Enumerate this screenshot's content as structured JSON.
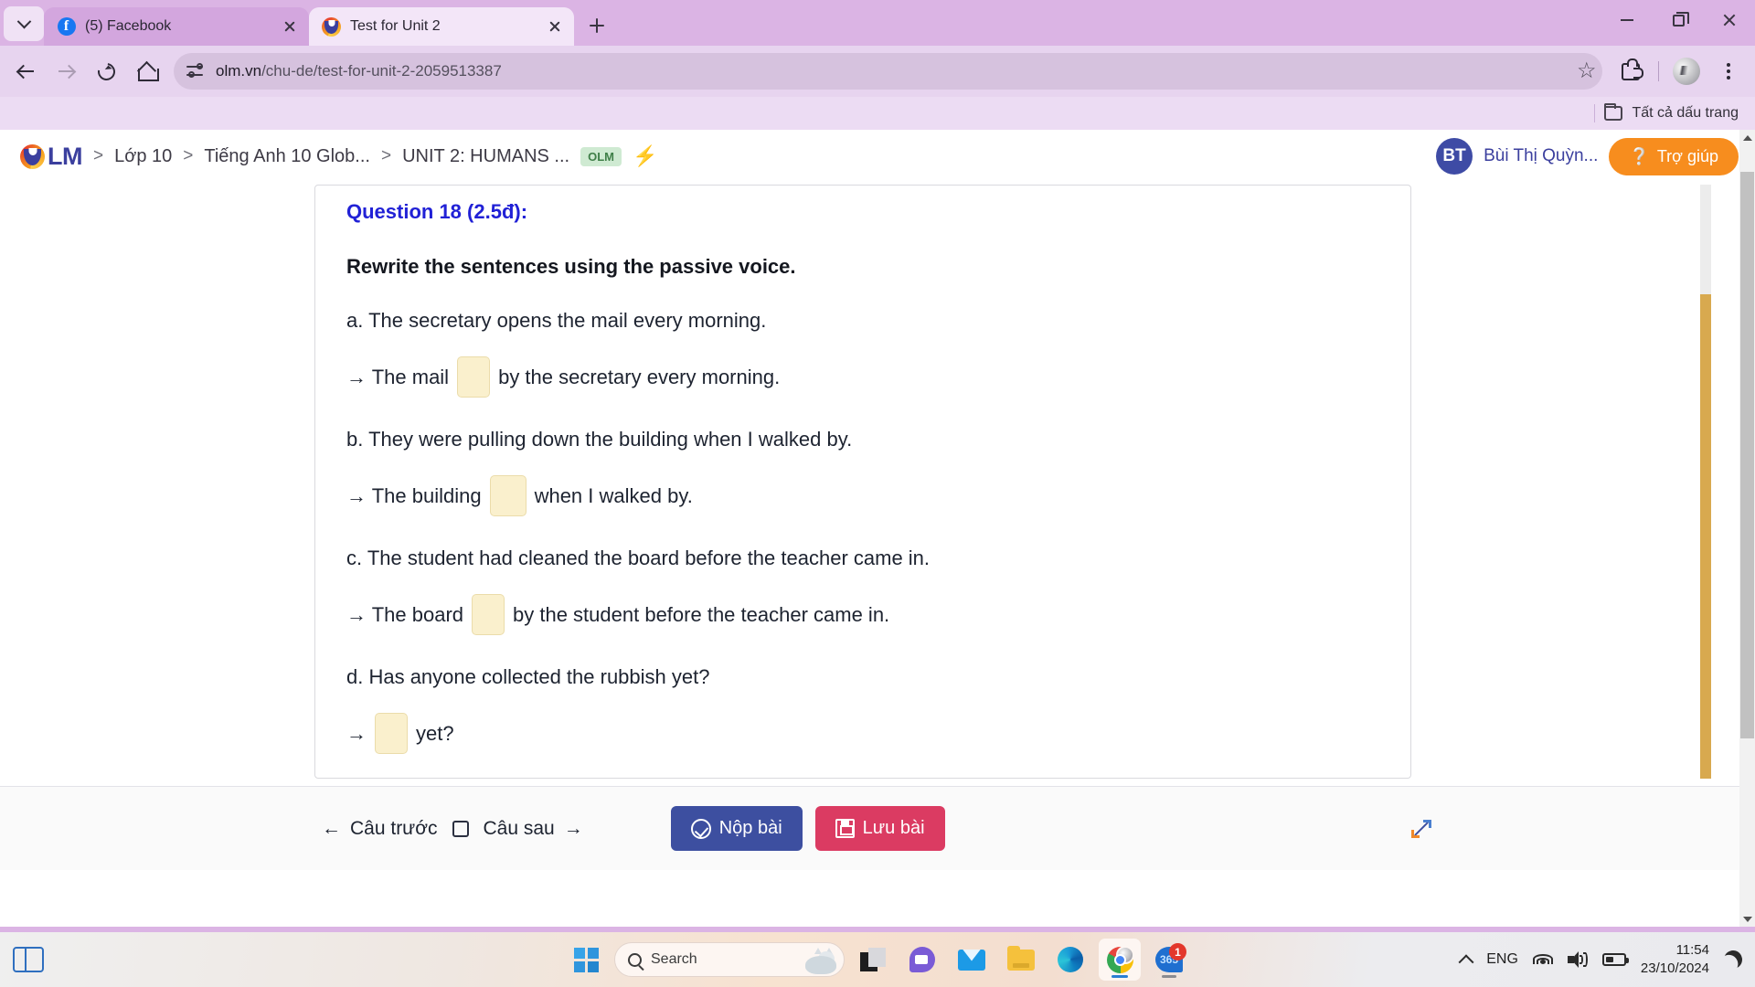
{
  "browser": {
    "tabs": [
      {
        "title": "(5) Facebook",
        "favicon": "facebook-icon",
        "active": false
      },
      {
        "title": "Test for Unit 2",
        "favicon": "olm-icon",
        "active": true
      }
    ],
    "new_tab_label": "+",
    "url_host": "olm.vn",
    "url_path": "/chu-de/test-for-unit-2-2059513387",
    "bookmarks_label": "Tất cả dấu trang"
  },
  "olm_header": {
    "logo_text": "LM",
    "breadcrumb": [
      {
        "label": "Lớp 10"
      },
      {
        "label": "Tiếng Anh 10 Glob..."
      },
      {
        "label": "UNIT 2: HUMANS ..."
      }
    ],
    "separator": ">",
    "badge": "OLM",
    "user_initials": "BT",
    "user_name": "Bùi Thị Quỳn...",
    "help_label": "Trợ giúp"
  },
  "question": {
    "title": "Question 18 (2.5đ):",
    "instruction": "Rewrite the sentences using the passive voice.",
    "items": [
      {
        "prompt": "a. The secretary opens the mail every morning.",
        "answer_prefix": "→ The mail",
        "answer_suffix": "by the secretary every morning.",
        "blank_value": ""
      },
      {
        "prompt": "b. They were pulling down the building when I walked by.",
        "answer_prefix": "→ The building",
        "answer_suffix": "when I walked by.",
        "blank_value": ""
      },
      {
        "prompt": "c. The student had cleaned the board before the teacher came in.",
        "answer_prefix": "→ The board",
        "answer_suffix": "by the student before the teacher came in.",
        "blank_value": ""
      },
      {
        "prompt": "d. Has anyone collected the rubbish yet?",
        "answer_prefix": "→",
        "answer_suffix": "yet?",
        "blank_value": ""
      }
    ]
  },
  "actionbar": {
    "prev_label": "Câu trước",
    "next_label": "Câu sau",
    "submit_label": "Nộp bài",
    "save_label": "Lưu bài"
  },
  "taskbar": {
    "search_placeholder": "Search",
    "apps": [
      {
        "name": "snipping-tool-icon"
      },
      {
        "name": "teams-icon"
      },
      {
        "name": "mail-icon"
      },
      {
        "name": "file-explorer-icon"
      },
      {
        "name": "edge-icon"
      },
      {
        "name": "chrome-icon"
      },
      {
        "name": "office365-icon"
      }
    ],
    "office_badge_count": "1",
    "office_label": "365",
    "language": "ENG",
    "time": "11:54",
    "date": "23/10/2024"
  },
  "colors": {
    "browser_chrome": "#dbb4e4",
    "accent_blue": "#2121d6",
    "olm_brand": "#3b3f9e",
    "help_orange": "#f78d1e",
    "submit_blue": "#3d4fa0",
    "save_pink": "#db3b62",
    "blank_bg": "#faf0cd",
    "inner_scroll_thumb": "#d8a94f"
  }
}
